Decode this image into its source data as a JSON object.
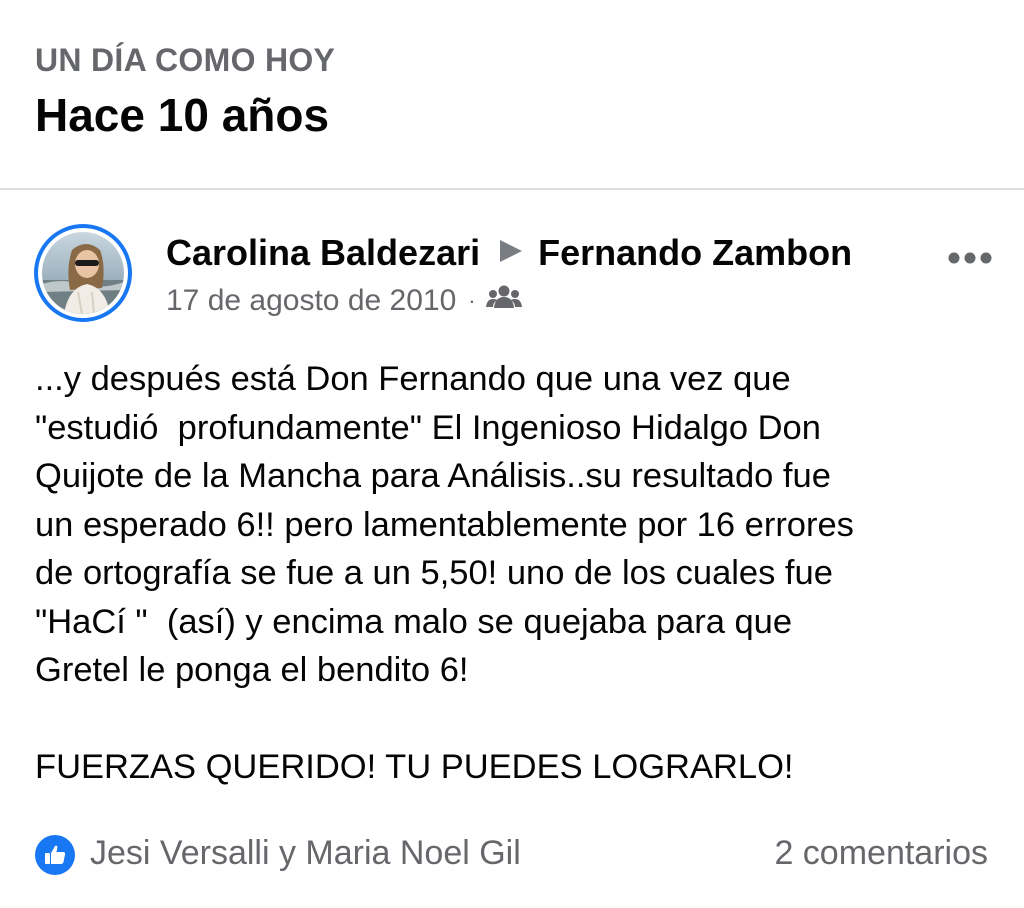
{
  "memory": {
    "kicker": "UN DÍA COMO HOY",
    "headline": "Hace 10 años"
  },
  "post": {
    "author": "Carolina Baldezari",
    "target": "Fernando Zambon",
    "arrow_icon": "triangle-right-icon",
    "date": "17 de agosto de 2010",
    "separator": "·",
    "audience_icon": "friends-icon",
    "more_icon": "more-horizontal-icon",
    "body_lines": [
      "...y después está Don Fernando que una vez que",
      "\"estudió  profundamente\" El Ingenioso Hidalgo Don",
      "Quijote de la Mancha para Análisis..su resultado fue",
      "un esperado 6!! pero lamentablemente por 16 errores",
      "de ortografía se fue a un 5,50! uno de los cuales fue",
      "\"HaCí \"  (así) y encima malo se quejaba para que",
      "Gretel le ponga el bendito 6!"
    ],
    "closing_line": "FUERZAS QUERIDO! TU PUEDES LOGRARLO!"
  },
  "footer": {
    "like_icon": "thumbs-up-icon",
    "reactors": "Jesi Versalli y Maria Noel Gil",
    "comments": "2 comentarios"
  },
  "colors": {
    "accent": "#1877f2",
    "secondary_text": "#65676b",
    "primary_text": "#050505",
    "divider": "#dadde1"
  }
}
